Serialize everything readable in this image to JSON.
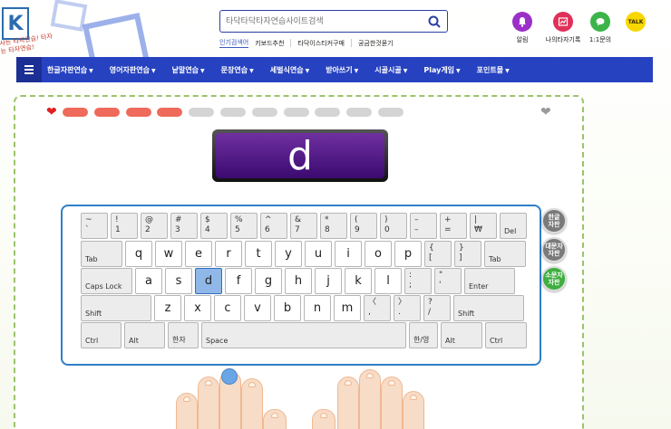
{
  "logo": {
    "letter": "K",
    "slogan": "사는 타자연습! 타자는 타자연습!"
  },
  "search": {
    "placeholder": "타닥타닥타자연습사이트검색",
    "icon": "search-icon"
  },
  "quick_links": {
    "tag": "인기검색어",
    "items": [
      "키보드추천",
      "타닥이스티커구매",
      "궁금한것묻기"
    ]
  },
  "header_icons": [
    {
      "label": "알림",
      "icon": "bell-icon",
      "color": "#9b30c8"
    },
    {
      "label": "나의타자기록",
      "icon": "chart-icon",
      "color": "#e0305a"
    },
    {
      "label": "1:1문의",
      "icon": "chat-icon",
      "color": "#3cb44a"
    },
    {
      "label": "",
      "icon": "kakaotalk-icon",
      "badge": "TALK",
      "color": "#f7d700"
    }
  ],
  "nav": {
    "items": [
      "한글자판연습",
      "영어자판연습",
      "낱말연습",
      "문장연습",
      "세벌식연습",
      "받아쓰기",
      "시골시골",
      "Play게임",
      "포인트몰"
    ]
  },
  "progress": {
    "total_pills": 11,
    "completed": 4,
    "completed_color": "#ef6a5a",
    "pending_color": "#d4d4d4"
  },
  "current_char": "d",
  "keyboard": {
    "rows": [
      [
        {
          "t": "~",
          "b": "`"
        },
        {
          "t": "!",
          "b": "1"
        },
        {
          "t": "@",
          "b": "2"
        },
        {
          "t": "#",
          "b": "3"
        },
        {
          "t": "$",
          "b": "4"
        },
        {
          "t": "%",
          "b": "5"
        },
        {
          "t": "^",
          "b": "6"
        },
        {
          "t": "&",
          "b": "7"
        },
        {
          "t": "*",
          "b": "8"
        },
        {
          "t": "(",
          "b": "9"
        },
        {
          "t": ")",
          "b": "0"
        },
        {
          "t": "–",
          "b": "–"
        },
        {
          "t": "+",
          "b": "="
        },
        {
          "t": "|",
          "b": "₩"
        },
        {
          "m": "Del"
        }
      ],
      [
        {
          "m": "Tab"
        },
        {
          "c": "q"
        },
        {
          "c": "w"
        },
        {
          "c": "e"
        },
        {
          "c": "r"
        },
        {
          "c": "t"
        },
        {
          "c": "y"
        },
        {
          "c": "u"
        },
        {
          "c": "i"
        },
        {
          "c": "o"
        },
        {
          "c": "p"
        },
        {
          "t": "{",
          "b": "["
        },
        {
          "t": "}",
          "b": "]"
        },
        {
          "m": "Tab"
        }
      ],
      [
        {
          "m": "Caps Lock"
        },
        {
          "c": "a"
        },
        {
          "c": "s"
        },
        {
          "c": "d"
        },
        {
          "c": "f"
        },
        {
          "c": "g"
        },
        {
          "c": "h"
        },
        {
          "c": "j"
        },
        {
          "c": "k"
        },
        {
          "c": "l"
        },
        {
          "t": ":",
          "b": ";"
        },
        {
          "t": "\"",
          "b": "'"
        },
        {
          "m": "Enter"
        }
      ],
      [
        {
          "m": "Shift"
        },
        {
          "c": "z"
        },
        {
          "c": "x"
        },
        {
          "c": "c"
        },
        {
          "c": "v"
        },
        {
          "c": "b"
        },
        {
          "c": "n"
        },
        {
          "c": "m"
        },
        {
          "t": "〈",
          "b": ","
        },
        {
          "t": "〉",
          "b": "."
        },
        {
          "t": "?",
          "b": "/"
        },
        {
          "m": "Shift"
        }
      ],
      [
        {
          "m": "Ctrl"
        },
        {
          "m": "Alt"
        },
        {
          "m": "한자"
        },
        {
          "m": "Space"
        },
        {
          "m": "한/영"
        },
        {
          "m": "Alt"
        },
        {
          "m": "Ctrl"
        }
      ]
    ],
    "active_key": "d"
  },
  "side_buttons": [
    {
      "line1": "한글",
      "line2": "자판",
      "color": "#7a7a7a"
    },
    {
      "line1": "대문자",
      "line2": "자판",
      "color": "#7a7a7a"
    },
    {
      "line1": "소문자",
      "line2": "자판",
      "color": "#3fae3f"
    }
  ]
}
